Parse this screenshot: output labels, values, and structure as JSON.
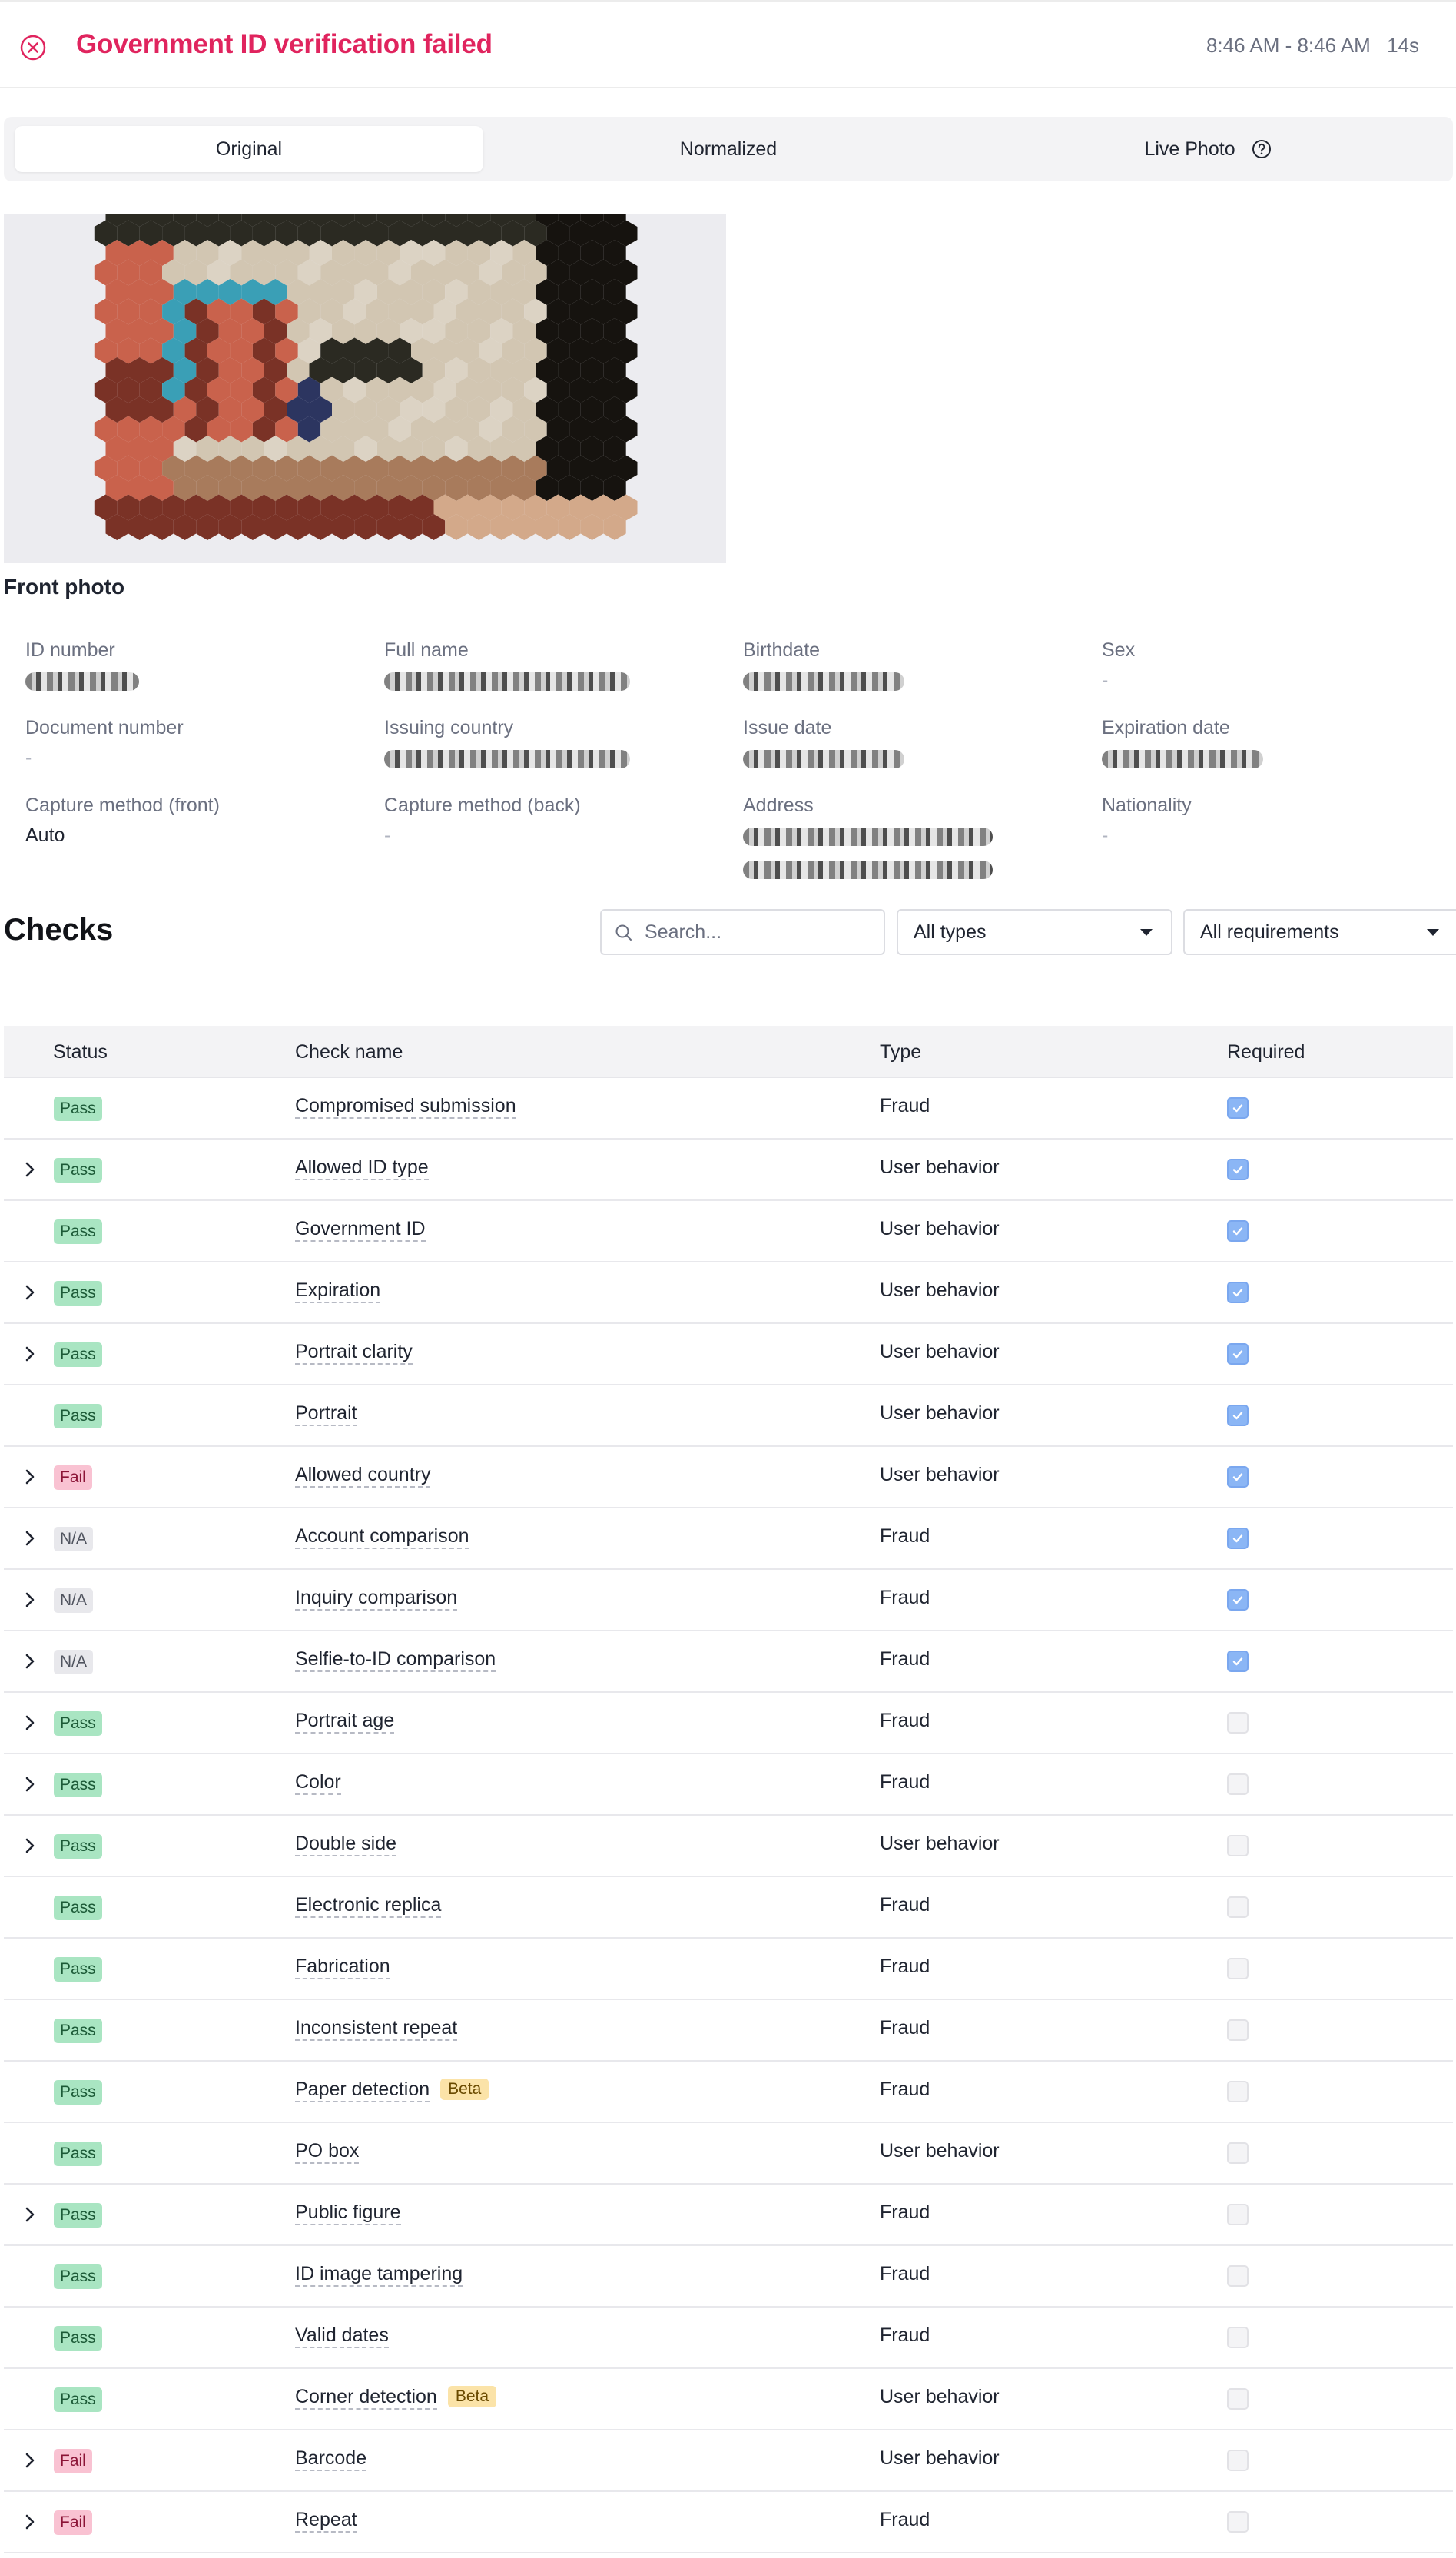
{
  "header": {
    "title": "Government ID verification failed",
    "time_range": "8:46 AM - 8:46 AM",
    "duration": "14s"
  },
  "tabs": [
    {
      "label": "Original",
      "active": true
    },
    {
      "label": "Normalized",
      "active": false
    },
    {
      "label": "Live Photo",
      "active": false
    }
  ],
  "photo": {
    "caption": "Front photo"
  },
  "fields": {
    "id_number": {
      "label": "ID number",
      "value": ""
    },
    "full_name": {
      "label": "Full name",
      "value": ""
    },
    "birthdate": {
      "label": "Birthdate",
      "value": ""
    },
    "sex": {
      "label": "Sex",
      "value": "-"
    },
    "document_number": {
      "label": "Document number",
      "value": "-"
    },
    "issuing_country": {
      "label": "Issuing country",
      "value": ""
    },
    "issue_date": {
      "label": "Issue date",
      "value": ""
    },
    "expiration_date": {
      "label": "Expiration date",
      "value": ""
    },
    "capture_front": {
      "label": "Capture method (front)",
      "value": "Auto"
    },
    "capture_back": {
      "label": "Capture method (back)",
      "value": "-"
    },
    "address": {
      "label": "Address",
      "value": ""
    },
    "nationality": {
      "label": "Nationality",
      "value": "-"
    }
  },
  "checks": {
    "title": "Checks",
    "search_placeholder": "Search...",
    "type_filter": "All types",
    "requirement_filter": "All requirements",
    "columns": {
      "status": "Status",
      "name": "Check name",
      "type": "Type",
      "required": "Required"
    },
    "rows": [
      {
        "expandable": false,
        "status": "Pass",
        "name": "Compromised submission",
        "type": "Fraud",
        "required": true
      },
      {
        "expandable": true,
        "status": "Pass",
        "name": "Allowed ID type",
        "type": "User behavior",
        "required": true
      },
      {
        "expandable": false,
        "status": "Pass",
        "name": "Government ID",
        "type": "User behavior",
        "required": true
      },
      {
        "expandable": true,
        "status": "Pass",
        "name": "Expiration",
        "type": "User behavior",
        "required": true
      },
      {
        "expandable": true,
        "status": "Pass",
        "name": "Portrait clarity",
        "type": "User behavior",
        "required": true
      },
      {
        "expandable": false,
        "status": "Pass",
        "name": "Portrait",
        "type": "User behavior",
        "required": true
      },
      {
        "expandable": true,
        "status": "Fail",
        "name": "Allowed country",
        "type": "User behavior",
        "required": true
      },
      {
        "expandable": true,
        "status": "N/A",
        "name": "Account comparison",
        "type": "Fraud",
        "required": true
      },
      {
        "expandable": true,
        "status": "N/A",
        "name": "Inquiry comparison",
        "type": "Fraud",
        "required": true
      },
      {
        "expandable": true,
        "status": "N/A",
        "name": "Selfie-to-ID comparison",
        "type": "Fraud",
        "required": true
      },
      {
        "expandable": true,
        "status": "Pass",
        "name": "Portrait age",
        "type": "Fraud",
        "required": false
      },
      {
        "expandable": true,
        "status": "Pass",
        "name": "Color",
        "type": "Fraud",
        "required": false
      },
      {
        "expandable": true,
        "status": "Pass",
        "name": "Double side",
        "type": "User behavior",
        "required": false
      },
      {
        "expandable": false,
        "status": "Pass",
        "name": "Electronic replica",
        "type": "Fraud",
        "required": false
      },
      {
        "expandable": false,
        "status": "Pass",
        "name": "Fabrication",
        "type": "Fraud",
        "required": false
      },
      {
        "expandable": false,
        "status": "Pass",
        "name": "Inconsistent repeat",
        "type": "Fraud",
        "required": false
      },
      {
        "expandable": false,
        "status": "Pass",
        "name": "Paper detection",
        "badge": "Beta",
        "type": "Fraud",
        "required": false
      },
      {
        "expandable": false,
        "status": "Pass",
        "name": "PO box",
        "type": "User behavior",
        "required": false
      },
      {
        "expandable": true,
        "status": "Pass",
        "name": "Public figure",
        "type": "Fraud",
        "required": false
      },
      {
        "expandable": false,
        "status": "Pass",
        "name": "ID image tampering",
        "type": "Fraud",
        "required": false
      },
      {
        "expandable": false,
        "status": "Pass",
        "name": "Valid dates",
        "type": "Fraud",
        "required": false
      },
      {
        "expandable": false,
        "status": "Pass",
        "name": "Corner detection",
        "badge": "Beta",
        "type": "User behavior",
        "required": false
      },
      {
        "expandable": true,
        "status": "Fail",
        "name": "Barcode",
        "type": "User behavior",
        "required": false
      },
      {
        "expandable": true,
        "status": "Fail",
        "name": "Repeat",
        "type": "Fraud",
        "required": false
      }
    ]
  },
  "colors": {
    "error": "#e0245e",
    "pass_bg": "#a9e5c2",
    "fail_bg": "#f9c2d2",
    "na_bg": "#e8e8ec",
    "checkbox_on": "#8bb6f5"
  }
}
